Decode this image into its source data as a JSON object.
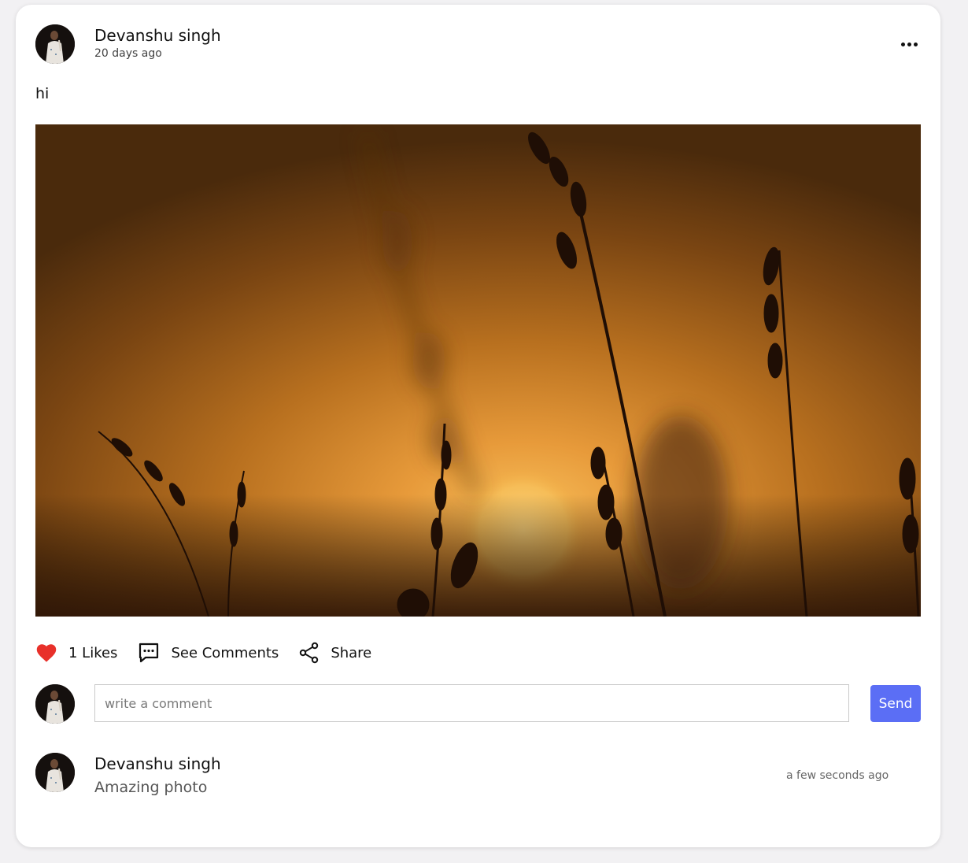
{
  "post": {
    "author": "Devanshu singh",
    "time": "20 days ago",
    "text": "hi",
    "image_description_icon": "sunset-grass-photo"
  },
  "actions": {
    "likes_label": "1 Likes",
    "comments_label": "See Comments",
    "share_label": "Share"
  },
  "comment_box": {
    "placeholder": "write a comment",
    "value": "",
    "send_label": "Send"
  },
  "comments": [
    {
      "author": "Devanshu singh",
      "text": "Amazing photo",
      "time": "a few seconds ago"
    }
  ],
  "colors": {
    "accent": "#5b6ef5",
    "like": "#e8302a",
    "card": "#ffffff",
    "background": "#f2f1f3"
  }
}
